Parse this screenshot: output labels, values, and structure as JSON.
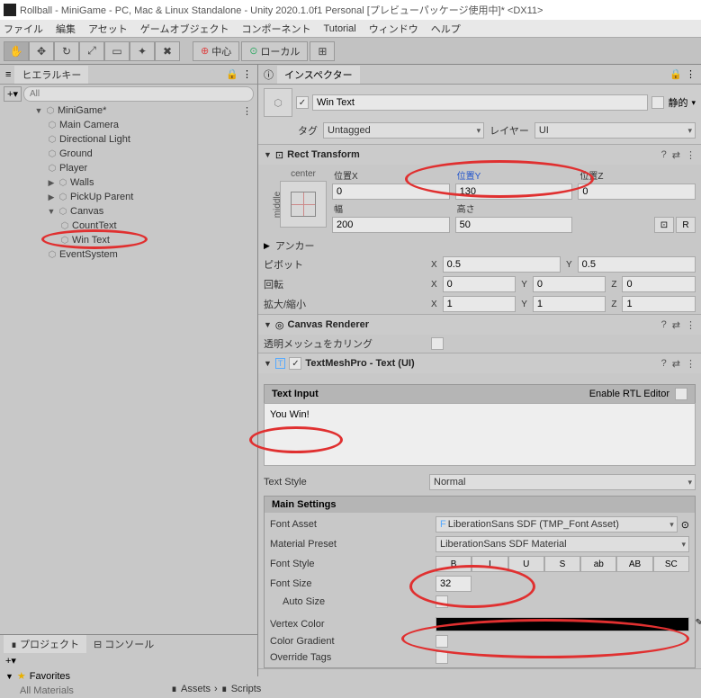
{
  "window_title": "Rollball - MiniGame - PC, Mac & Linux Standalone - Unity 2020.1.0f1 Personal [プレビューパッケージ使用中]* <DX11>",
  "menu": [
    "ファイル",
    "編集",
    "アセット",
    "ゲームオブジェクト",
    "コンポーネント",
    "Tutorial",
    "ウィンドウ",
    "ヘルプ"
  ],
  "toolbar": {
    "pivot": "中心",
    "local": "ローカル"
  },
  "hierarchy": {
    "tab": "ヒエラルキー",
    "search_placeholder": "All",
    "root": "MiniGame*",
    "items": [
      "Main Camera",
      "Directional Light",
      "Ground",
      "Player",
      "Walls",
      "PickUp Parent",
      "Canvas"
    ],
    "canvas_children": [
      "CountText",
      "Win Text"
    ],
    "last": "EventSystem"
  },
  "inspector": {
    "tab": "インスペクター",
    "name": "Win Text",
    "static": "静的",
    "tag_label": "タグ",
    "tag": "Untagged",
    "layer_label": "レイヤー",
    "layer": "UI",
    "rect": {
      "title": "Rect Transform",
      "center": "center",
      "middle": "middle",
      "posx_label": "位置X",
      "posy_label": "位置Y",
      "posz_label": "位置Z",
      "posx": "0",
      "posy": "130",
      "posz": "0",
      "w_label": "幅",
      "h_label": "高さ",
      "w": "200",
      "h": "50",
      "anchor": "アンカー",
      "pivot": "ピボット",
      "pivx": "0.5",
      "pivy": "0.5",
      "rotation": "回転",
      "rx": "0",
      "ry": "0",
      "rz": "0",
      "scale": "拡大/縮小",
      "sx": "1",
      "sy": "1",
      "sz": "1",
      "r_btn": "R"
    },
    "canvas_renderer": {
      "title": "Canvas Renderer",
      "cull": "透明メッシュをカリング"
    },
    "tmp": {
      "title": "TextMeshPro - Text (UI)",
      "text_input": "Text Input",
      "rtl": "Enable RTL Editor",
      "text": "You Win!",
      "text_style_label": "Text Style",
      "text_style": "Normal",
      "main_settings": "Main Settings",
      "font_asset_label": "Font Asset",
      "font_asset": "LiberationSans SDF (TMP_Font Asset)",
      "material_label": "Material Preset",
      "material": "LiberationSans SDF Material",
      "font_style_label": "Font Style",
      "styles": [
        "B",
        "I",
        "U",
        "S",
        "ab",
        "AB",
        "SC"
      ],
      "font_size_label": "Font Size",
      "font_size": "32",
      "auto_size": "Auto Size",
      "vertex_color_label": "Vertex Color",
      "color_gradient": "Color Gradient",
      "override_tags": "Override Tags"
    }
  },
  "project": {
    "project": "プロジェクト",
    "console": "コンソール",
    "favorites": "Favorites",
    "allmat": "All Materials",
    "assets": "Assets",
    "scripts": "Scripts"
  }
}
